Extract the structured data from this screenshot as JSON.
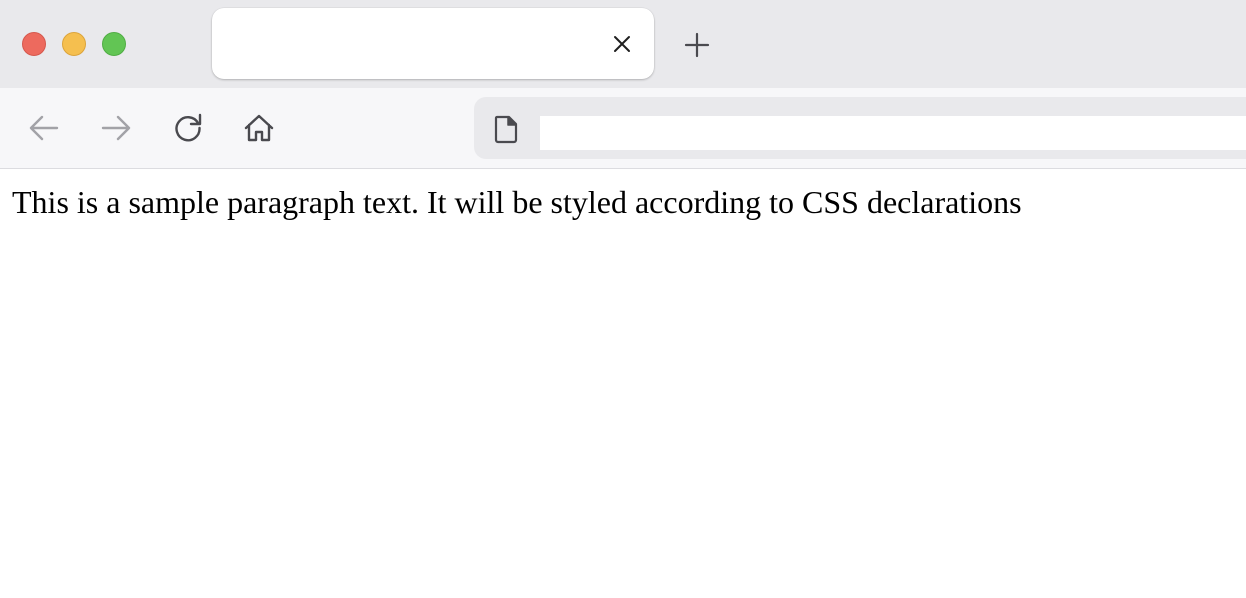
{
  "browser": {
    "window_controls": [
      "close",
      "minimize",
      "zoom"
    ],
    "tab": {
      "title": "",
      "close_icon": "close-icon"
    },
    "new_tab_icon": "plus-icon",
    "toolbar": {
      "back_icon": "arrow-left-icon",
      "forward_icon": "arrow-right-icon",
      "reload_icon": "reload-icon",
      "home_icon": "home-icon",
      "page_icon": "document-icon",
      "address": {
        "value": "",
        "placeholder": ""
      }
    }
  },
  "page": {
    "paragraph": "This is a sample paragraph text. It will be styled according to CSS declarations"
  },
  "colors": {
    "close": "#ed6a5e",
    "minimize": "#f5bf4f",
    "zoom": "#62c554",
    "tabstrip_bg": "#e9e9ec",
    "toolbar_bg": "#f7f7f9"
  }
}
